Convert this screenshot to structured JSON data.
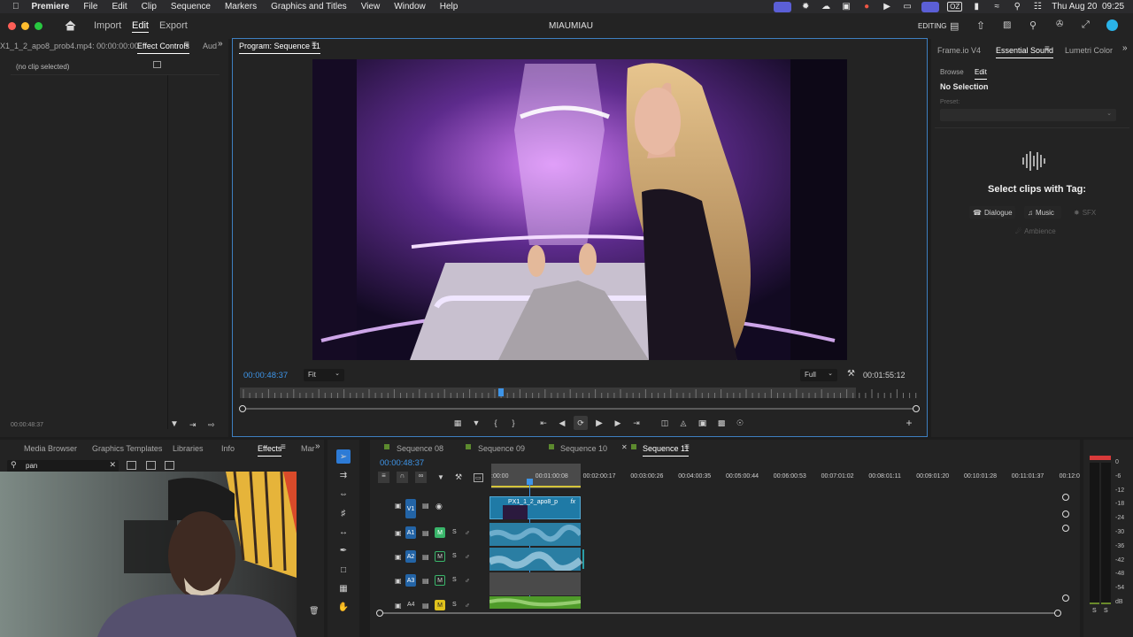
{
  "menubar": {
    "app": "Premiere",
    "items": [
      "File",
      "Edit",
      "Clip",
      "Sequence",
      "Markers",
      "Graphics and Titles",
      "View",
      "Window",
      "Help"
    ],
    "badge": "OZ",
    "datetime": "Thu Aug 20  09:25"
  },
  "header": {
    "nav": [
      "Import",
      "Edit",
      "Export"
    ],
    "project": "MIAUMIAU",
    "mode": "EDITING"
  },
  "source_panel": {
    "tab_clip": "X1_1_2_apo8_prob4.mp4: 00:00:00:00",
    "tab_effect_controls": "Effect Controls",
    "tab_audio": "Aud",
    "no_clip": "(no clip selected)",
    "timecode": "00:00:48:37"
  },
  "program": {
    "title": "Program: Sequence 11",
    "timecode": "00:00:48:37",
    "fit": "Fit",
    "quality": "Full",
    "duration": "00:01:55:12",
    "playhead_fraction": 0.42
  },
  "right_panel": {
    "tabs": [
      "Frame.io V4",
      "Essential Sound",
      "Lumetri Color"
    ],
    "subtabs": [
      "Browse",
      "Edit"
    ],
    "selection": "No Selection",
    "preset_label": "Preset:",
    "select_title": "Select clips with Tag:",
    "tags": [
      "Dialogue",
      "Music",
      "SFX",
      "Ambience"
    ]
  },
  "effects_panel": {
    "tabs": [
      "Media Browser",
      "Graphics Templates",
      "Libraries",
      "Info",
      "Effects",
      "Mar"
    ],
    "search_value": "pan"
  },
  "timeline": {
    "tabs": [
      "Sequence 08",
      "Sequence 09",
      "Sequence 10",
      "Sequence 11"
    ],
    "tab_colors": [
      "#5c8a2e",
      "#5c8a2e",
      "#5c8a2e",
      "#5c8a2e"
    ],
    "timecode": "00:00:48:37",
    "ruler": [
      ":00:00",
      "00:01:00:08",
      "00:02:00:17",
      "00:03:00:26",
      "00:04:00:35",
      "00:05:00:44",
      "00:06:00:53",
      "00:07:01:02",
      "00:08:01:11",
      "00:09:01:20",
      "00:10:01:28",
      "00:11:01:37",
      "00:12:0"
    ],
    "tracks": [
      {
        "target": "V1",
        "name": "V1"
      },
      {
        "target": "A1",
        "name": "A1"
      },
      {
        "target": "A2",
        "name": "A2"
      },
      {
        "target": "A3",
        "name": "A3"
      },
      {
        "target": "",
        "name": "A4"
      }
    ],
    "clip_name": "PX1_1_2_apo8_p",
    "fx": "fx",
    "m_label": "M",
    "s_label": "S"
  },
  "meter": {
    "labels": [
      "0",
      "-6",
      "-12",
      "-18",
      "-24",
      "-30",
      "-36",
      "-42",
      "-48",
      "-54",
      "dB"
    ],
    "solo": [
      "S",
      "S"
    ]
  },
  "colors": {
    "accent_blue": "#2d7bd6",
    "timecode_blue": "#3e95e8",
    "clip_video": "#1f7aa6",
    "clip_audio": "#2aa1a6",
    "clip_green": "#4f9b2a",
    "track_target": "#2364a6",
    "m_green": "#39b56a"
  }
}
